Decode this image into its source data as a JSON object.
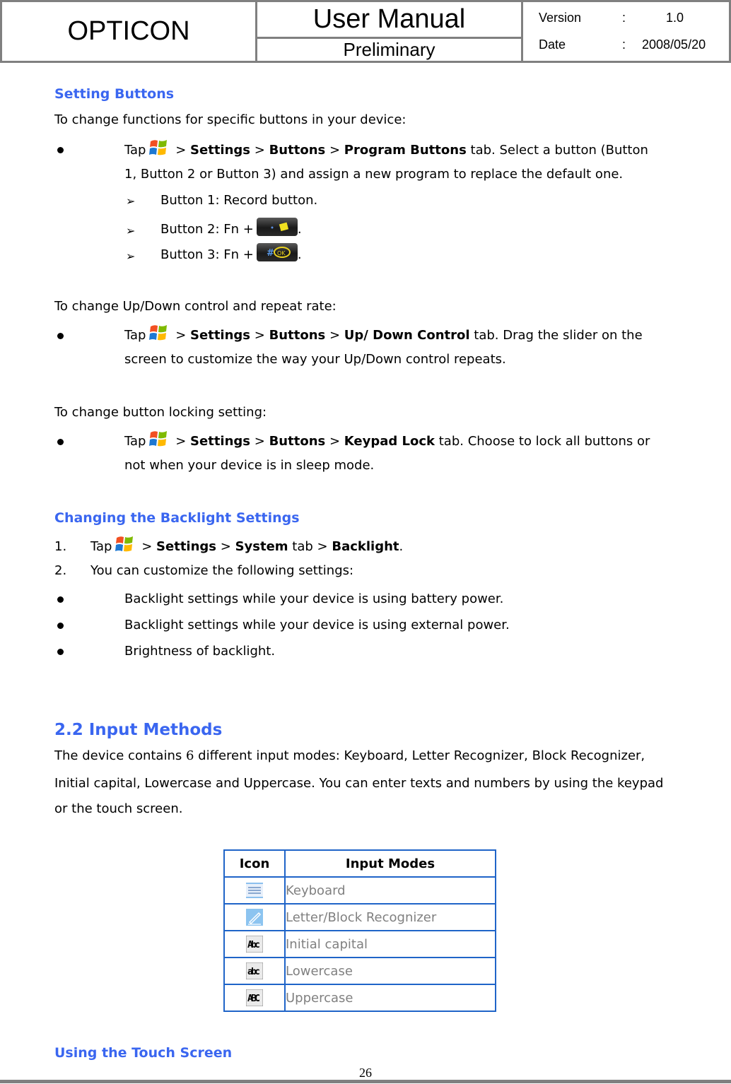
{
  "header": {
    "company": "OPTICON",
    "title": "User Manual",
    "status": "Preliminary",
    "version_label": "Version",
    "version_value": "1.0",
    "date_label": "Date",
    "date_value": "2008/05/20",
    "separator": ":"
  },
  "setting_buttons": {
    "heading": "Setting Buttons",
    "intro": "To change functions for specific buttons in your device:",
    "tap": "Tap",
    "gt": ">",
    "step_settings": "Settings",
    "step_buttons": "Buttons",
    "step_program_buttons": "Program Buttons",
    "step_tail_1": "tab. Select a button (Button",
    "step_tail_2": "1, Button 2 or Button 3) and assign a new program to replace the default one.",
    "sub_items": [
      {
        "text": "Button 1: Record button."
      },
      {
        "text": "Button 2: Fn +",
        "icon": "windows-key-icon"
      },
      {
        "text": "Button 3: Fn +",
        "icon": "ok-key-icon"
      }
    ],
    "period": ".",
    "updown_intro": "To change Up/Down control and repeat rate:",
    "updown_bold": "Up/ Down Control",
    "updown_tail_1": "tab. Drag the slider on the",
    "updown_tail_2": "screen to customize the way your Up/Down control repeats.",
    "lock_intro": "To change button locking setting:",
    "lock_bold": "Keypad Lock",
    "lock_tail_1": "tab. Choose to lock all buttons or",
    "lock_tail_2": "not when your device is in sleep mode."
  },
  "backlight": {
    "heading": "Changing the Backlight Settings",
    "step1_num": "1.",
    "step1_settings": "Settings",
    "step1_system": "System",
    "step1_tab": "tab",
    "step1_backlight": "Backlight",
    "step2_num": "2.",
    "step2_text": "You can customize the following settings:",
    "items": [
      "Backlight settings while your device is using battery power.",
      "Backlight settings while your device is using external power.",
      "Brightness of backlight."
    ]
  },
  "input_methods": {
    "heading": "2.2 Input Methods",
    "para_1a": "The device contains ",
    "para_1n": "6",
    "para_1b": " different input modes: Keyboard, Letter Recognizer, Block Recognizer,",
    "para_2": "Initial capital, Lowercase and Uppercase. You can enter texts and numbers by using the keypad",
    "para_3": "or the touch screen.",
    "table": {
      "headers": [
        "Icon",
        "Input Modes"
      ],
      "rows": [
        {
          "icon": "keyboard-icon",
          "mode": "Keyboard"
        },
        {
          "icon": "pen-recognizer-icon",
          "mode": "Letter/Block Recognizer"
        },
        {
          "icon": "initial-capital-icon",
          "mode": "Initial capital",
          "glyph": "Abc"
        },
        {
          "icon": "lowercase-icon",
          "mode": "Lowercase",
          "glyph": "abc"
        },
        {
          "icon": "uppercase-icon",
          "mode": "Uppercase",
          "glyph": "ABC"
        }
      ]
    }
  },
  "touch_screen": {
    "heading": "Using the Touch Screen"
  },
  "footer": {
    "page_number": "26"
  },
  "colors": {
    "heading_blue": "#3a66f0",
    "table_border": "#1f64c8",
    "frame_gray": "#808080"
  }
}
